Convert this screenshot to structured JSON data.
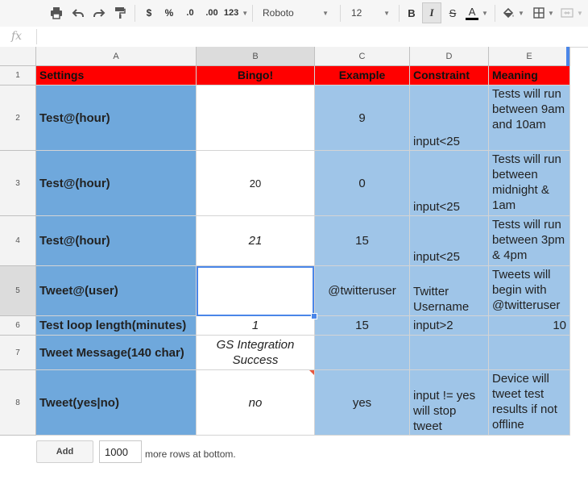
{
  "toolbar": {
    "font_name": "Roboto",
    "font_size": "12",
    "currency": "$",
    "percent": "%",
    "decrease_decimals": ".0",
    "increase_decimals": ".00",
    "more_formats": "123",
    "bold": "B",
    "italic": "I",
    "strikethrough": "S",
    "text_color": "A"
  },
  "formula_bar": {
    "fx_label": "fx",
    "value": ""
  },
  "columns": [
    "A",
    "B",
    "C",
    "D",
    "E"
  ],
  "rows": [
    "1",
    "2",
    "3",
    "4",
    "5",
    "6",
    "7",
    "8"
  ],
  "cells": {
    "r1": {
      "a": "Settings",
      "b": "Bingo!",
      "c": "Example",
      "d": "Constraint",
      "e": "Meaning"
    },
    "r2": {
      "a": "Test@(hour)",
      "b": "",
      "c": "9",
      "d": "input<25",
      "e": "Tests will run between 9am and 10am"
    },
    "r3": {
      "a": "Test@(hour)",
      "b": "20",
      "c": "0",
      "d": "input<25",
      "e": "Tests will run between midnight & 1am"
    },
    "r4": {
      "a": "Test@(hour)",
      "b": "21",
      "c": "15",
      "d": "input<25",
      "e": "Tests will run between 3pm & 4pm"
    },
    "r5": {
      "a": "Tweet@(user)",
      "b": "",
      "c": "@twitteruser",
      "d": "Twitter Username",
      "e": "Tweets will begin with @twitteruser"
    },
    "r6": {
      "a": "Test loop length(minutes)",
      "b": "1",
      "c": "15",
      "d": "input>2",
      "e": "10"
    },
    "r7": {
      "a": "Tweet Message(140 char)",
      "b": "GS Integration Success",
      "c": "",
      "d": "",
      "e": ""
    },
    "r8": {
      "a": "Tweet(yes|no)",
      "b": "no",
      "c": "yes",
      "d": "input != yes will stop tweet",
      "e": "Device will tweet test results if not offline"
    }
  },
  "footer": {
    "add_label": "Add",
    "rows_value": "1000",
    "more_rows_text": "more rows at bottom."
  },
  "colors": {
    "header_red": "#ff0000",
    "dark_blue": "#6fa8dc",
    "light_blue": "#9fc5e8",
    "selection": "#4a86e8"
  }
}
